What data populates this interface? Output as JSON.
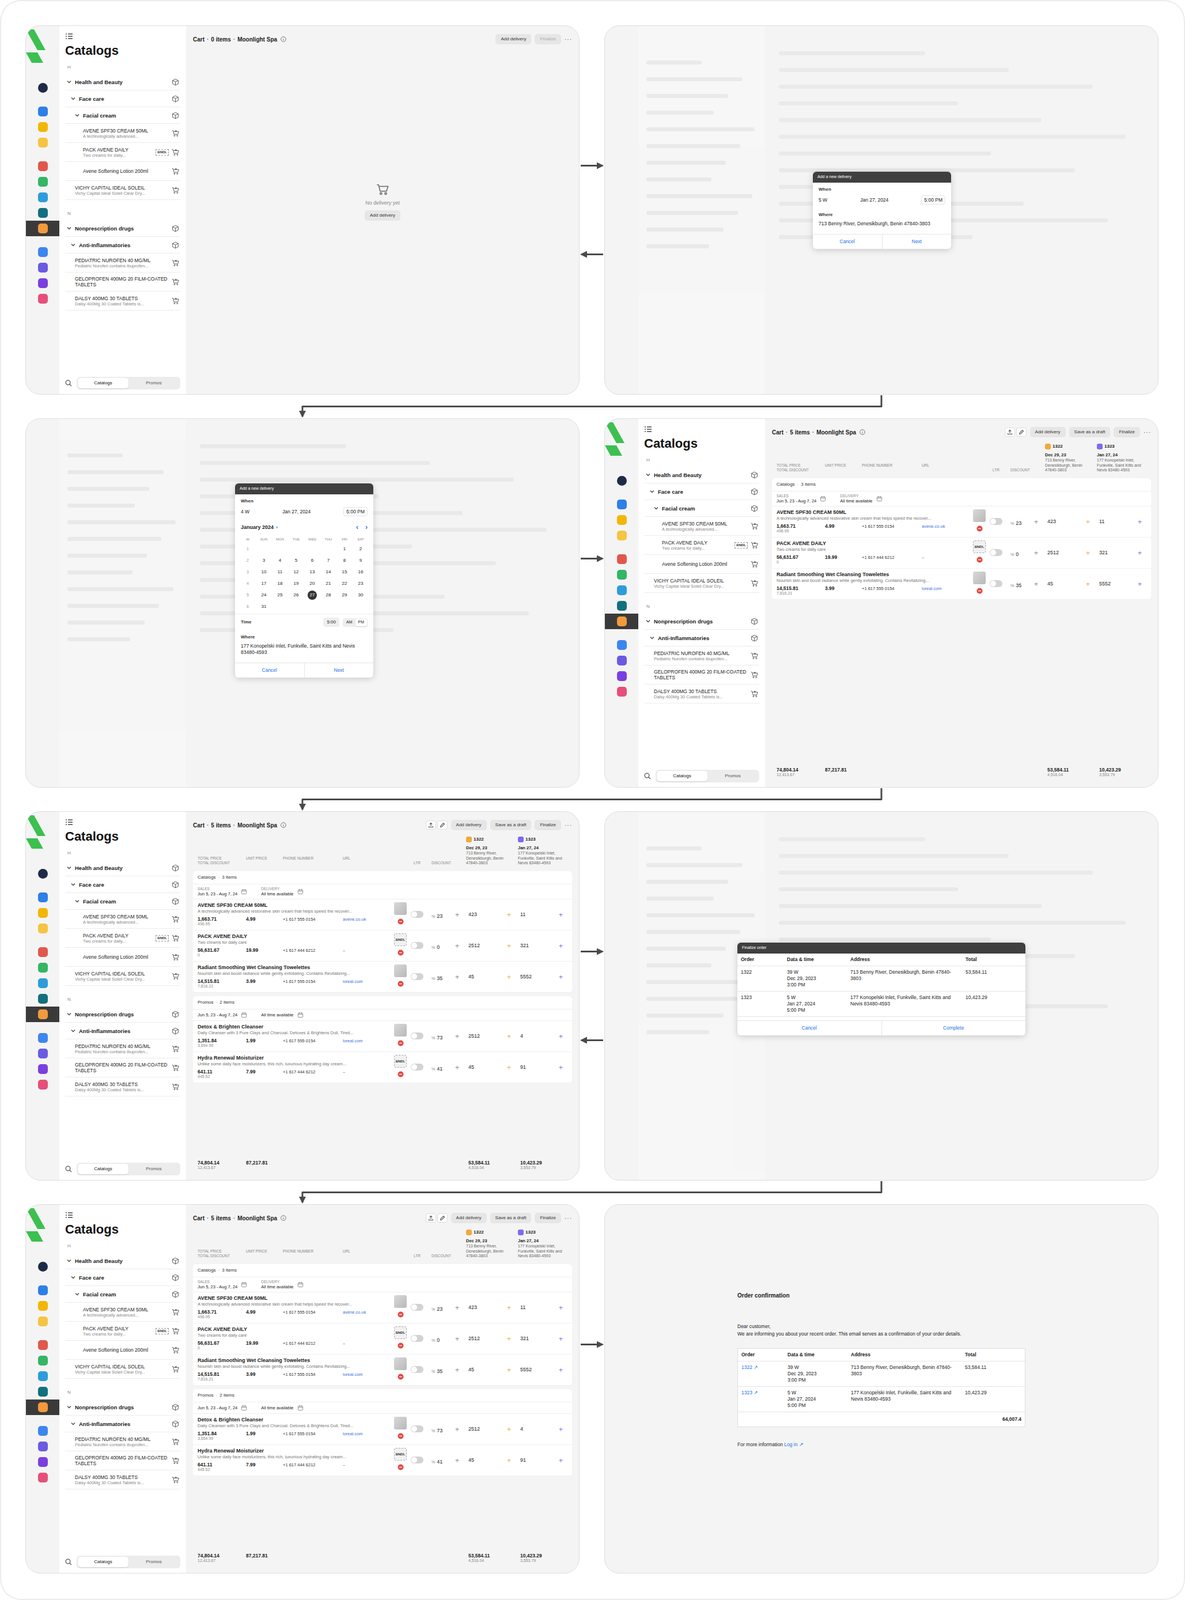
{
  "rail": [
    {
      "kind": "avatar",
      "color": "#1e2b47",
      "selected": false
    },
    {
      "kind": "app",
      "color": "#2f7fe8",
      "selected": false
    },
    {
      "kind": "app",
      "color": "#f2b705",
      "selected": false
    },
    {
      "kind": "app",
      "color": "#f6c443",
      "selected": false
    },
    {
      "kind": "app",
      "color": "#e2574c",
      "selected": false
    },
    {
      "kind": "app",
      "color": "#35b565",
      "selected": false
    },
    {
      "kind": "app",
      "color": "#2d9cdb",
      "selected": false
    },
    {
      "kind": "app",
      "color": "#13707e",
      "selected": false
    },
    {
      "kind": "app",
      "color": "#f29a3c",
      "selected": true
    },
    {
      "kind": "app",
      "color": "#3c86f0",
      "selected": false
    },
    {
      "kind": "app",
      "color": "#6a5be2",
      "selected": false
    },
    {
      "kind": "app",
      "color": "#7a3fe0",
      "selected": false
    },
    {
      "kind": "app",
      "color": "#e64f79",
      "selected": false
    }
  ],
  "sidebar": {
    "title": "Catalogs",
    "sections": [
      {
        "letter": "H",
        "items": [
          {
            "kind": "group",
            "label": "Health and Beauty",
            "depth": 0,
            "expanded": true
          },
          {
            "kind": "group",
            "label": "Face care",
            "depth": 1,
            "expanded": true
          },
          {
            "kind": "group",
            "label": "Facial cream",
            "depth": 2,
            "expanded": true
          },
          {
            "kind": "product",
            "label": "AVENE SPF30 CREAM 50ML",
            "desc": "A technologically advanced...",
            "depth": 2
          },
          {
            "kind": "product",
            "label": "PACK AVENE DAILY",
            "desc": "Two creams for daily...",
            "badge": "BNDL",
            "depth": 2
          },
          {
            "kind": "product",
            "label": "Avene Softening Lotion 200ml",
            "depth": 2
          },
          {
            "kind": "product",
            "label": "VICHY CAPITAL IDEAL SOLEIL",
            "desc": "Vichy Capital Ideal Soleil Clear Dry...",
            "depth": 0
          }
        ]
      },
      {
        "letter": "N",
        "items": [
          {
            "kind": "group",
            "label": "Nonprescription drugs",
            "depth": 0,
            "expanded": true
          },
          {
            "kind": "group",
            "label": "Anti-Inflammatories",
            "depth": 1,
            "expanded": true
          },
          {
            "kind": "product",
            "label": "PEDIATRIC NUROFEN 40 MG/ML",
            "desc": "Pediatric Nurofen contains ibuprofen...",
            "depth": 0
          },
          {
            "kind": "product",
            "label": "GELOPROFEN 400MG 20 FILM-COATED TABLETS",
            "depth": 0
          },
          {
            "kind": "product",
            "label": "DALSY 400MG 30 TABLETS",
            "desc": "Dalsy 400Mg 30 Coated Tablets is...",
            "depth": 0
          }
        ]
      }
    ],
    "tabs": [
      {
        "label": "Catalogs",
        "selected": true
      },
      {
        "label": "Promos",
        "selected": false
      }
    ]
  },
  "cart": {
    "title": "Cart",
    "sep": "·",
    "count": "5 items",
    "shop": "Moonlight Spa",
    "buttons": [
      {
        "label": "Add delivery",
        "disabled": false
      },
      {
        "label": "Save as a draft",
        "disabled": false
      },
      {
        "label": "Finalize",
        "disabled": false
      }
    ],
    "more": "···",
    "columns": {
      "total_price": "TOTAL PRICE",
      "total_discount": "TOTAL DISCOUNT",
      "unit_price": "UNIT PRICE",
      "phone": "PHONE NUMBER",
      "url": "URL",
      "ltr": "LTR",
      "discount": "DISCOUNT"
    },
    "percent": "%",
    "plus": "+",
    "deliveries": [
      {
        "order": "1322",
        "date": "Dec 29, 23",
        "address": "713 Benny River, Denesikburgh, Benin 47840-3803",
        "color": "#f2a93b",
        "total": "53,584.11",
        "discount": "4,516.04"
      },
      {
        "order": "1323",
        "date": "Jan 27, 24",
        "address": "177 Konopelski Inlet, Funkville, Saint Kitts and Nevis 83480-4593",
        "color": "#7b6cf0",
        "total": "10,423.29",
        "discount": "3,553.79"
      }
    ],
    "groups": [
      {
        "title": "Catalogs",
        "count": "3 items",
        "sales_label": "SALES",
        "sales": "Jun 5, 23 - Aug 7, 24",
        "delivery_label": "DELIVERY",
        "delivery": "All time available",
        "items": [
          {
            "name": "AVENE SPF30 CREAM 50ML",
            "desc": "A technologically advanced restorative skin cream that helps speed the recover...",
            "price": "1,663.71",
            "discount": "496.95",
            "unit": "4.99",
            "phone": "+1 617 555 0154",
            "url": "avene.co.uk",
            "on": false,
            "disc": "23",
            "qty": [
              "423",
              "11"
            ]
          },
          {
            "name": "PACK AVENE DAILY",
            "desc": "Two creams for daily care",
            "price": "56,631.67",
            "discount": "0",
            "unit": "19.99",
            "phone": "+1 617 444 6212",
            "url": "–",
            "on": false,
            "disc": "0",
            "qty": [
              "2512",
              "321"
            ],
            "badge": "BNDL"
          },
          {
            "name": "Radiant Smoothing Wet Cleansing Towelettes",
            "desc": "Nourish skin and boost radiance while gently exfoliating. Contains Revitalizing...",
            "price": "14,515.81",
            "discount": "7,816.21",
            "unit": "3.99",
            "phone": "+1 617 555 0154",
            "url": "loreal.com",
            "on": false,
            "disc": "35",
            "qty": [
              "45",
              "5552"
            ]
          }
        ]
      },
      {
        "title": "Promos",
        "count": "2 items",
        "sales": "Jun 5, 23 - Aug 7, 24",
        "delivery": "All time available",
        "items": [
          {
            "name": "Detox & Brighten Cleanser",
            "desc": "Daily Cleanser with 3 Pure Clays and Charcoal. Detoxes & Brightens Dull, Tired...",
            "price": "1,351.84",
            "discount": "3,654.99",
            "unit": "1.99",
            "phone": "+1 617 555 0154",
            "url": "loreal.com",
            "on": false,
            "disc": "73",
            "qty": [
              "2512",
              "4"
            ]
          },
          {
            "name": "Hydra Renewal Moisturizer",
            "desc": "Unlike some daily face moisturizers, this rich, luxurious hydrating day cream...",
            "price": "641.11",
            "discount": "445.52",
            "unit": "7.99",
            "phone": "+1 617 444 6212",
            "url": "–",
            "on": false,
            "disc": "41",
            "qty": [
              "45",
              "91"
            ],
            "badge": "BNDL"
          }
        ]
      }
    ],
    "totals": {
      "price": "74,804.14",
      "discount": "12,413.67",
      "unit": "87,217.81"
    }
  },
  "orders": [
    {
      "order": "1322",
      "week": "39 W",
      "date": "Dec 29, 2023",
      "time": "3:00 PM",
      "address": "713 Benny River, Denesikburgh, Benin 47840-3803",
      "total": "53,584.11"
    },
    {
      "order": "1323",
      "week": "5 W",
      "date": "Jan 27, 2024",
      "time": "5:00 PM",
      "address": "177 Konopelski Inlet, Funkville, Saint Kitts and Nevis 83480-4593",
      "total": "10,423.29"
    }
  ],
  "panels": [
    {
      "kind": "cart_empty",
      "title": "Cart",
      "sep": "·",
      "count": "0 items",
      "shop": "Moonlight Spa",
      "buttons": [
        {
          "label": "Add delivery",
          "disabled": false
        },
        {
          "label": "Finalize",
          "disabled": true
        }
      ],
      "more": "···",
      "empty": "No delivery yet",
      "cta": "Add delivery"
    },
    {
      "kind": "delivery",
      "title": "Add a new delivery",
      "when_label": "When",
      "week": "5 W",
      "date": "Jan 27, 2024",
      "time": "5:00 PM",
      "where_label": "Where",
      "address": "713 Benny River, Denesikburgh, Benin 47840-3803",
      "cancel": "Cancel",
      "next": "Next"
    },
    {
      "kind": "calendar",
      "title": "Add a new delivery",
      "when_label": "When",
      "week": "4 W",
      "date": "Jan 27, 2024",
      "time": "5:00 PM",
      "month": "January 2024",
      "month_chevron": "›",
      "prev": "‹",
      "next_month": "›",
      "weekdays": [
        "W",
        "SUN",
        "MON",
        "TUE",
        "WED",
        "THU",
        "FRI",
        "SAT"
      ],
      "weeks": [
        {
          "week": "1",
          "days": [
            {
              "d": "1",
              "selected": false
            },
            {
              "d": "2",
              "selected": false
            }
          ]
        },
        {
          "week": "2",
          "days": [
            {
              "d": "3",
              "selected": false
            },
            {
              "d": "4",
              "selected": false
            },
            {
              "d": "5",
              "selected": false
            },
            {
              "d": "6",
              "selected": false
            },
            {
              "d": "7",
              "selected": false
            },
            {
              "d": "8",
              "selected": false
            },
            {
              "d": "9",
              "selected": false
            }
          ]
        },
        {
          "week": "3",
          "days": [
            {
              "d": "10",
              "selected": false
            },
            {
              "d": "11",
              "selected": false
            },
            {
              "d": "12",
              "selected": false
            },
            {
              "d": "13",
              "selected": false
            },
            {
              "d": "14",
              "selected": false
            },
            {
              "d": "15",
              "selected": false
            },
            {
              "d": "16",
              "selected": false
            }
          ]
        },
        {
          "week": "4",
          "days": [
            {
              "d": "17",
              "selected": false
            },
            {
              "d": "18",
              "selected": false
            },
            {
              "d": "19",
              "selected": false
            },
            {
              "d": "20",
              "selected": false
            },
            {
              "d": "21",
              "selected": false
            },
            {
              "d": "22",
              "selected": false
            },
            {
              "d": "23",
              "selected": false
            }
          ]
        },
        {
          "week": "5",
          "days": [
            {
              "d": "24",
              "selected": false
            },
            {
              "d": "25",
              "selected": false
            },
            {
              "d": "26",
              "selected": false
            },
            {
              "d": "27",
              "selected": true
            },
            {
              "d": "28",
              "selected": false
            },
            {
              "d": "29",
              "selected": false
            },
            {
              "d": "30",
              "selected": false
            }
          ]
        },
        {
          "week": "6",
          "days": [
            {
              "d": "31",
              "selected": false
            }
          ]
        }
      ],
      "time_label": "Time",
      "time_value": "5:00",
      "meridiem": [
        {
          "label": "AM",
          "selected": false
        },
        {
          "label": "PM",
          "selected": true
        }
      ],
      "where_label": "Where",
      "address": "177 Konopelski Inlet, Funkville, Saint Kitts and Nevis 83480-4593",
      "cancel": "Cancel",
      "next": "Next"
    },
    {
      "kind": "cart",
      "show_promos": false
    },
    {
      "kind": "cart",
      "show_promos": true
    },
    {
      "kind": "finalize",
      "title": "Finalize order",
      "columns": [
        "Order",
        "Data & time",
        "Address",
        "Total"
      ],
      "cancel": "Cancel",
      "complete": "Complete"
    },
    {
      "kind": "cart",
      "show_promos": true
    },
    {
      "kind": "email",
      "title": "Order confirmation",
      "greeting": "Dear customer,",
      "body": "We are informing you about your recent order. This email serves as a confirmation of your order details.",
      "columns": [
        "Order",
        "Data & time",
        "Address",
        "Total"
      ],
      "link": "↗",
      "grand_total": "64,007.4",
      "footer": "For more information",
      "login": "Log in ↗"
    }
  ],
  "arrows": [
    {
      "from": 0,
      "to": 1
    },
    {
      "from": 1,
      "to": 0
    },
    {
      "from": 1,
      "to": 2
    },
    {
      "from": 2,
      "to": 3
    },
    {
      "from": 3,
      "to": 4
    },
    {
      "from": 4,
      "to": 5
    },
    {
      "from": 5,
      "to": 4
    },
    {
      "from": 5,
      "to": 6
    },
    {
      "from": 6,
      "to": 7
    }
  ]
}
